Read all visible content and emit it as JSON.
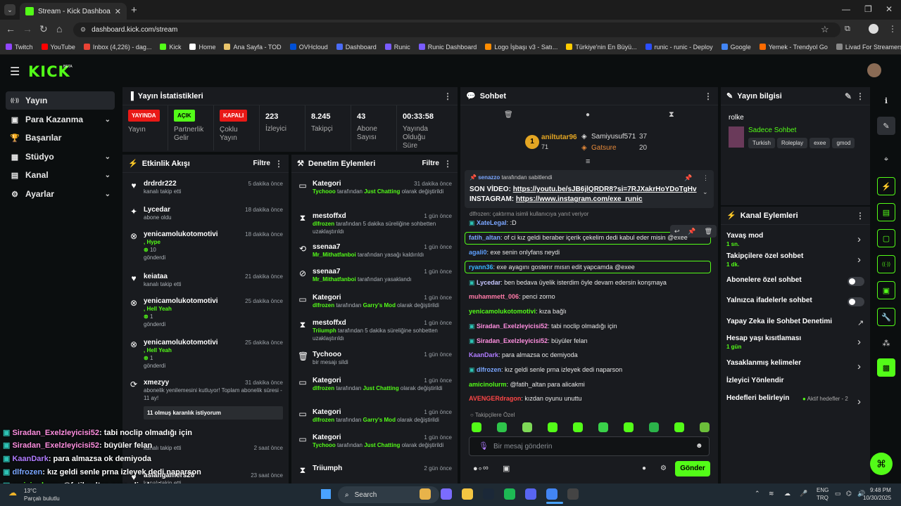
{
  "browser": {
    "tab_title": "Stream - Kick Dashboard",
    "url": "dashboard.kick.com/stream",
    "bookmarks": [
      "Twitch",
      "YouTube",
      "Inbox (4,226) - dag...",
      "Kick",
      "Home",
      "Ana Sayfa - TOD",
      "OVHcloud",
      "Dashboard",
      "Runic",
      "Runic Dashboard",
      "Logo İşbaşı v3 - Satı...",
      "Türkiye'nin En Büyü...",
      "runic - runic - Deploy",
      "Google",
      "Yemek - Trendyol Go",
      "Livad For Streamers"
    ]
  },
  "logo": "KICK",
  "sidebar": {
    "items": [
      {
        "label": "Yayın",
        "icon": "broadcast-icon"
      },
      {
        "label": "Para Kazanma",
        "icon": "money-icon"
      },
      {
        "label": "Başarılar",
        "icon": "trophy-icon"
      },
      {
        "label": "Stüdyo",
        "icon": "studio-icon"
      },
      {
        "label": "Kanal",
        "icon": "channel-icon"
      },
      {
        "label": "Ayarlar",
        "icon": "gear-icon"
      }
    ]
  },
  "stats": {
    "title": "Yayın İstatistikleri",
    "items": [
      {
        "badge": "YAYINDA",
        "label": "Yayın",
        "color": "#e91916"
      },
      {
        "badge": "AÇIK",
        "label": "Partnerlik Gelir",
        "color": "#53fc18"
      },
      {
        "badge": "KAPALI",
        "label": "Çoklu Yayın",
        "color": "#e91916"
      },
      {
        "value": "223",
        "label": "İzleyici"
      },
      {
        "value": "8.245",
        "label": "Takipçi"
      },
      {
        "value": "43",
        "label": "Abone Sayısı"
      },
      {
        "value": "00:33:58",
        "label": "Yayında Olduğu Süre"
      }
    ]
  },
  "activity": {
    "title": "Etkinlik Akışı",
    "filter": "Filtre",
    "items": [
      {
        "name": "drdrdr222",
        "time": "5 dakika önce",
        "sub": "kanalı takip etti"
      },
      {
        "name": "Lycedar",
        "time": "18 dakika önce",
        "sub": "abone oldu"
      },
      {
        "name": "yenicamolukotomotivi",
        "time": "18 dakika önce",
        "gift": ", Hype",
        "count": "10",
        "sub": "gönderdi"
      },
      {
        "name": "keiataa",
        "time": "21 dakika önce",
        "sub": "kanalı takip etti"
      },
      {
        "name": "yenicamolukotomotivi",
        "time": "25 dakika önce",
        "gift": ", Hell Yeah",
        "count": "1",
        "sub": "gönderdi"
      },
      {
        "name": "yenicamolukotomotivi",
        "time": "25 dakika önce",
        "gift": ", Hell Yeah",
        "count": "1",
        "sub": "gönderdi"
      },
      {
        "name": "xmezyy",
        "time": "31 dakika önce",
        "sub": "abonelik yenilemesini kutluyor! Toplam abonelik süresi - 11 ay!",
        "msg": "11 olmuş karanlık istiyorum"
      },
      {
        "name": "",
        "time": "2 saat önce",
        "sub": "kanalı takip etti"
      },
      {
        "name": "aslangamers28",
        "time": "23 saat önce",
        "sub": "kanalı takip etti"
      }
    ]
  },
  "moderation": {
    "title": "Denetim Eylemleri",
    "filter": "Filtre",
    "items": [
      {
        "name": "Kategori",
        "time": "31 dakika önce",
        "actor": "Tychooo",
        "mid": " tarafından ",
        "target": "Just Chatting",
        "end": " olarak değiştirildi"
      },
      {
        "name": "mestoffxd",
        "time": "1 gün önce",
        "actor": "dlfrozen",
        "mid": " tarafından 5 dakika süreliğine sohbetten uzaklaştırıldı",
        "target": "",
        "end": ""
      },
      {
        "name": "ssenaa7",
        "time": "1 gün önce",
        "actor": "Mr_Mithatfanboi",
        "mid": " tarafından yasağı kaldırıldı",
        "target": "",
        "end": ""
      },
      {
        "name": "ssenaa7",
        "time": "1 gün önce",
        "actor": "Mr_Mithatfanboi",
        "mid": " tarafından yasaklandı",
        "target": "",
        "end": ""
      },
      {
        "name": "Kategori",
        "time": "1 gün önce",
        "actor": "dlfrozen",
        "mid": " tarafından ",
        "target": "Garry's Mod",
        "end": " olarak değiştirildi"
      },
      {
        "name": "mestoffxd",
        "time": "1 gün önce",
        "actor": "Triiumph",
        "mid": " tarafından 5 dakika süreliğine sohbetten uzaklaştırıldı",
        "target": "",
        "end": ""
      },
      {
        "name": "Tychooo",
        "time": "1 gün önce",
        "actor": "",
        "mid": "bir mesajı sildi",
        "target": "",
        "end": ""
      },
      {
        "name": "Kategori",
        "time": "1 gün önce",
        "actor": "dlfrozen",
        "mid": " tarafından ",
        "target": "Just Chatting",
        "end": " olarak değiştirildi"
      },
      {
        "name": "Kategori",
        "time": "1 gün önce",
        "actor": "dlfrozen",
        "mid": " tarafından ",
        "target": "Garry's Mod",
        "end": " olarak değiştirildi"
      },
      {
        "name": "Kategori",
        "time": "1 gün önce",
        "actor": "Tychooo",
        "mid": " tarafından ",
        "target": "Just Chatting",
        "end": " olarak değiştirildi"
      },
      {
        "name": "Triiumph",
        "time": "2 gün önce",
        "actor": "",
        "mid": "",
        "target": "",
        "end": ""
      }
    ]
  },
  "chat": {
    "title": "Sohbet",
    "leaders": {
      "first": "aniltutar96",
      "first_n": "71",
      "second": "Samiyusuf571",
      "second_n": "37",
      "third": "Gatsure",
      "third_n": "20"
    },
    "pinned": {
      "by": "senazzo",
      "by_text": " tarafından sabitlendi",
      "line1": "SON VİDEO: ",
      "link1": "https://youtu.be/sJB6jlQRDR8?si=7RJXakrHoYDoTgHv",
      "line2": "INSTAGRAM: ",
      "link2": "https://www.instagram.com/exe_runic"
    },
    "reply_hint": "dlfrozen: çaktırma isimli kullanıcıya yanıt veriyor",
    "messages": [
      {
        "user": "XateLegal",
        "text": ":D",
        "color": "#7aa6ff"
      },
      {
        "user": "fatih_altan",
        "text": "of ci kız geldi beraber içerik çekelim dedi kabul eder misin @exee",
        "color": "#7aa6ff"
      },
      {
        "user": "agali0",
        "text": "exe senin onlyfans neydi",
        "color": "#5ea0ff"
      },
      {
        "user": "ryann36",
        "text": "exe ayagını gosterır mısın edit yapcamda @exee",
        "color": "#38b6ff"
      },
      {
        "user": "Lycedar",
        "text": "ben bedava üyelik isterdim öyle devam edersin konşmaya",
        "color": "#c6c6ff"
      },
      {
        "user": "muhammett_006",
        "text": "penci zorno",
        "color": "#ff7aa8"
      },
      {
        "user": "yenicamolukotomotivi",
        "text": "kıza bağlı",
        "color": "#53fc18"
      },
      {
        "user": "Siradan_Exelzleyicisi52",
        "text": "tabi noclip olmadığı için",
        "color": "#ff8fe0"
      },
      {
        "user": "Siradan_Exelzleyicisi52",
        "text": "büyüler felan",
        "color": "#ff8fe0"
      },
      {
        "user": "KaanDark",
        "text": "para almazsa oc demiyoda",
        "color": "#b07cff"
      },
      {
        "user": "dlfrozen",
        "text": "kız geldi senle prna izleyek dedi naparson",
        "color": "#7aa6ff"
      },
      {
        "user": "amicinolurm",
        "text": "@fatih_altan para alicakmi",
        "color": "#53fc18"
      },
      {
        "user": "AVENGERdragon",
        "text": "kızdan oyunu unuttu",
        "color": "#ff4646"
      }
    ],
    "followers_only": "Takipçilere Özel",
    "input_placeholder": "Bir mesaj gönderin",
    "send": "Gönder"
  },
  "stream_info": {
    "title": "Yayın bilgisi",
    "name": "rolke",
    "category": "Sadece Sohbet",
    "tags": [
      "Turkish",
      "Roleplay",
      "exee",
      "gmod"
    ]
  },
  "channel_actions": {
    "title": "Kanal Eylemleri",
    "items": [
      {
        "label": "Yavaş mod",
        "sub": "1 sn.",
        "ctrl": "chev"
      },
      {
        "label": "Takipçilere özel sohbet",
        "sub": "1 dk.",
        "ctrl": "chev"
      },
      {
        "label": "Abonelere özel sohbet",
        "sub": "",
        "ctrl": "toggle"
      },
      {
        "label": "Yalnızca ifadelerle sohbet",
        "sub": "",
        "ctrl": "toggle"
      },
      {
        "label": "Yapay Zeka ile Sohbet Denetimi",
        "sub": "",
        "ctrl": "ext"
      },
      {
        "label": "Hesap yaşı kısıtlaması",
        "sub": "1 gün",
        "ctrl": "chev"
      },
      {
        "label": "Yasaklanmış kelimeler",
        "sub": "",
        "ctrl": "chev"
      },
      {
        "label": "İzleyici Yönlendir",
        "sub": "",
        "ctrl": ""
      },
      {
        "label": "Hedefleri belirleyin",
        "sub": "",
        "ctrl": "chev",
        "status": "Aktif hedefler - 2"
      }
    ]
  },
  "overlay": [
    {
      "user": "Siradan_Exelzleyicisi52",
      "text": ": tabi noclip olmadığı için"
    },
    {
      "user": "Siradan_Exelzleyicisi52",
      "text": ": büyüler felan"
    },
    {
      "user": "KaanDark",
      "text": ": para almazsa ok demiyoda"
    },
    {
      "user": "dlfrozen",
      "text": ": kız geldi senle prna izleyek dedi naparson"
    },
    {
      "user": "amicinolurm",
      "text": ": @fatih_altan para alicakmi"
    }
  ],
  "taskbar": {
    "temp": "13°C",
    "weather": "Parçalı bulutlu",
    "search": "Search",
    "lang1": "ENG",
    "lang2": "TRQ",
    "time": "9:48 PM",
    "date": "10/30/2025"
  }
}
